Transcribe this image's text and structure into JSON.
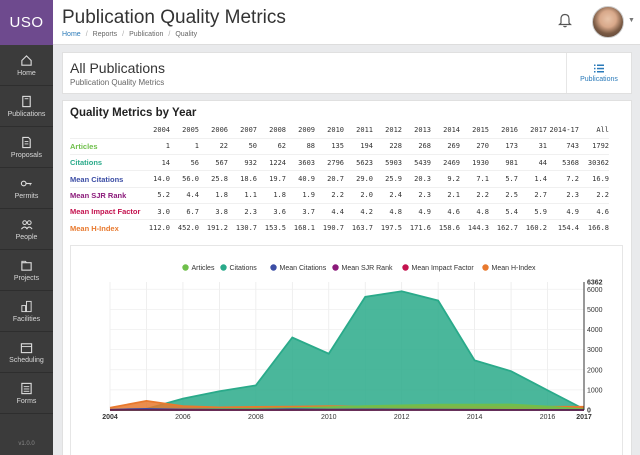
{
  "app": {
    "logo": "USO",
    "version": "v1.0.0"
  },
  "sidebar": {
    "items": [
      {
        "label": "Home",
        "icon": "home-icon"
      },
      {
        "label": "Publications",
        "icon": "book-icon"
      },
      {
        "label": "Proposals",
        "icon": "document-icon"
      },
      {
        "label": "Permits",
        "icon": "key-icon"
      },
      {
        "label": "People",
        "icon": "people-icon"
      },
      {
        "label": "Projects",
        "icon": "folders-icon"
      },
      {
        "label": "Facilities",
        "icon": "building-icon"
      },
      {
        "label": "Scheduling",
        "icon": "calendar-icon"
      },
      {
        "label": "Forms",
        "icon": "list-icon"
      }
    ]
  },
  "header": {
    "title": "Publication Quality Metrics",
    "breadcrumb": [
      "Home",
      "Reports",
      "Publication",
      "Quality"
    ]
  },
  "summary_card": {
    "title": "All Publications",
    "subtitle": "Publication Quality Metrics",
    "button_label": "Publications"
  },
  "metrics": {
    "title": "Quality Metrics by Year",
    "columns": [
      "2004",
      "2005",
      "2006",
      "2007",
      "2008",
      "2009",
      "2010",
      "2011",
      "2012",
      "2013",
      "2014",
      "2015",
      "2016",
      "2017",
      "2014-17",
      "All"
    ],
    "rows": [
      {
        "label": "Articles",
        "color": "#6fbf4b",
        "values": [
          "1",
          "1",
          "22",
          "50",
          "62",
          "88",
          "135",
          "194",
          "228",
          "268",
          "269",
          "270",
          "173",
          "31",
          "743",
          "1792"
        ]
      },
      {
        "label": "Citations",
        "color": "#2aaa8a",
        "values": [
          "14",
          "56",
          "567",
          "932",
          "1224",
          "3603",
          "2796",
          "5623",
          "5903",
          "5439",
          "2469",
          "1930",
          "981",
          "44",
          "5368",
          "30362"
        ]
      },
      {
        "label": "Mean Citations",
        "color": "#3c4ea5",
        "values": [
          "14.0",
          "56.0",
          "25.8",
          "18.6",
          "19.7",
          "40.9",
          "20.7",
          "29.0",
          "25.9",
          "20.3",
          "9.2",
          "7.1",
          "5.7",
          "1.4",
          "7.2",
          "16.9"
        ]
      },
      {
        "label": "Mean SJR Rank",
        "color": "#8b1a7a",
        "values": [
          "5.2",
          "4.4",
          "1.8",
          "1.1",
          "1.8",
          "1.9",
          "2.2",
          "2.0",
          "2.4",
          "2.3",
          "2.1",
          "2.2",
          "2.5",
          "2.7",
          "2.3",
          "2.2"
        ]
      },
      {
        "label": "Mean Impact Factor",
        "color": "#c4134f",
        "values": [
          "3.0",
          "6.7",
          "3.8",
          "2.3",
          "3.6",
          "3.7",
          "4.4",
          "4.2",
          "4.8",
          "4.9",
          "4.6",
          "4.8",
          "5.4",
          "5.9",
          "4.9",
          "4.6"
        ]
      },
      {
        "label": "Mean H-Index",
        "color": "#e8792e",
        "values": [
          "112.0",
          "452.0",
          "191.2",
          "130.7",
          "153.5",
          "168.1",
          "190.7",
          "163.7",
          "197.5",
          "171.6",
          "158.6",
          "144.3",
          "162.7",
          "160.2",
          "154.4",
          "166.8"
        ]
      }
    ]
  },
  "chart_data": {
    "type": "area",
    "x": [
      2004,
      2005,
      2006,
      2007,
      2008,
      2009,
      2010,
      2011,
      2012,
      2013,
      2014,
      2015,
      2016,
      2017
    ],
    "x_ticks": [
      "2004",
      "2006",
      "2008",
      "2010",
      "2012",
      "2014",
      "2016",
      "2017"
    ],
    "y_ticks": [
      "0",
      "1000",
      "2000",
      "3000",
      "4000",
      "5000",
      "6000",
      "6362"
    ],
    "ylim": [
      0,
      6362
    ],
    "legend_position": "top",
    "series": [
      {
        "name": "Articles",
        "color": "#6fbf4b",
        "values": [
          1,
          1,
          22,
          50,
          62,
          88,
          135,
          194,
          228,
          268,
          269,
          270,
          173,
          31
        ]
      },
      {
        "name": "Citations",
        "color": "#2aaa8a",
        "values": [
          14,
          56,
          567,
          932,
          1224,
          3603,
          2796,
          5623,
          5903,
          5439,
          2469,
          1930,
          981,
          44
        ]
      },
      {
        "name": "Mean Citations",
        "color": "#3c4ea5",
        "values": [
          14.0,
          56.0,
          25.8,
          18.6,
          19.7,
          40.9,
          20.7,
          29.0,
          25.9,
          20.3,
          9.2,
          7.1,
          5.7,
          1.4
        ]
      },
      {
        "name": "Mean SJR Rank",
        "color": "#8b1a7a",
        "values": [
          5.2,
          4.4,
          1.8,
          1.1,
          1.8,
          1.9,
          2.2,
          2.0,
          2.4,
          2.3,
          2.1,
          2.2,
          2.5,
          2.7
        ]
      },
      {
        "name": "Mean Impact Factor",
        "color": "#c4134f",
        "values": [
          3.0,
          6.7,
          3.8,
          2.3,
          3.6,
          3.7,
          4.4,
          4.2,
          4.8,
          4.9,
          4.6,
          4.8,
          5.4,
          5.9
        ]
      },
      {
        "name": "Mean H-Index",
        "color": "#e8792e",
        "values": [
          112.0,
          452.0,
          191.2,
          130.7,
          153.5,
          168.1,
          190.7,
          163.7,
          197.5,
          171.6,
          158.6,
          144.3,
          162.7,
          160.2
        ]
      }
    ]
  }
}
